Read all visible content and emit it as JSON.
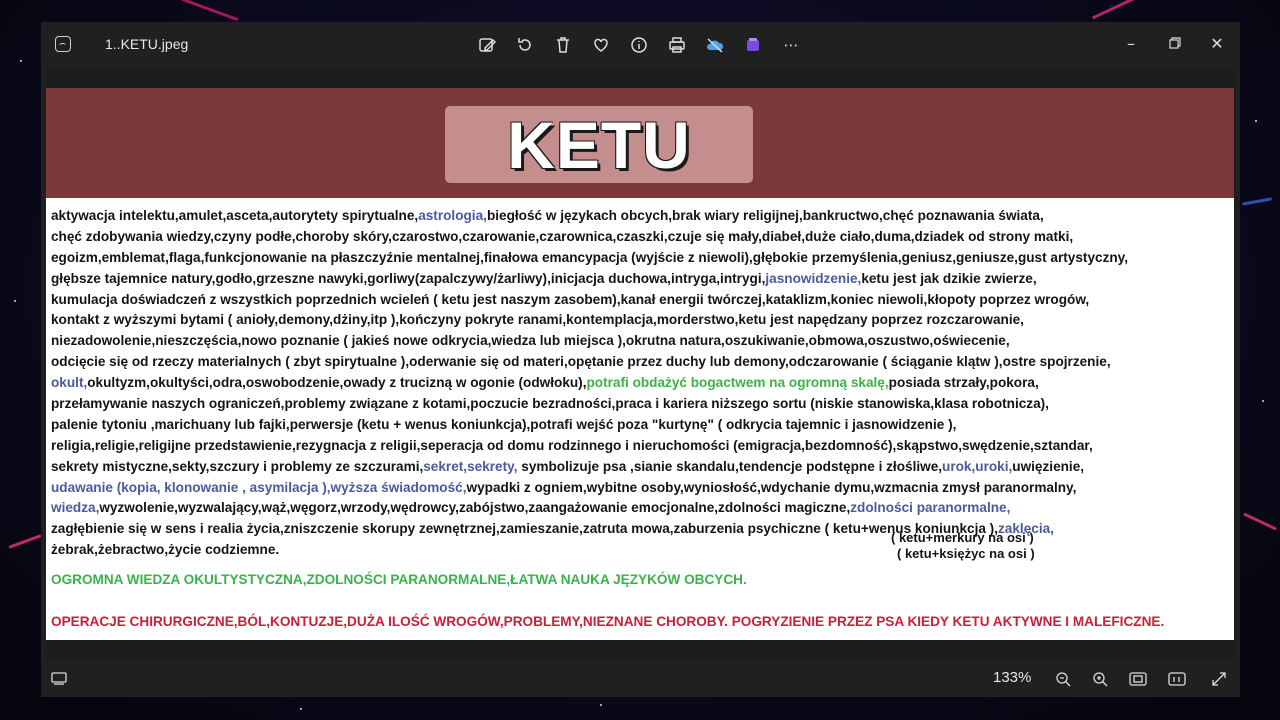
{
  "window": {
    "filename": "1..KETU.jpeg",
    "zoom": "133%"
  },
  "toolbar": {
    "icons": [
      "edit-image-icon",
      "rotate-icon",
      "delete-icon",
      "favorite-icon",
      "info-icon",
      "print-icon",
      "onedrive-icon",
      "clipchamp-icon",
      "more-icon"
    ]
  },
  "image_content": {
    "title": "KETU",
    "lines": [
      [
        {
          "t": "aktywacja intelektu,amulet,asceta,autorytety spirytualne,",
          "c": ""
        },
        {
          "t": "astrologia,",
          "c": "blue"
        },
        {
          "t": "biegłość w językach obcych,brak wiary religijnej,bankructwo,chęć poznawania świata,",
          "c": ""
        }
      ],
      [
        {
          "t": "chęć zdobywania wiedzy,czyny podłe,choroby skóry,czarostwo,czarowanie,czarownica,czaszki,czuje się mały,diabeł,duże ciało,duma,dziadek od strony matki,",
          "c": ""
        }
      ],
      [
        {
          "t": "egoizm,emblemat,flaga,funkcjonowanie na płaszczyźnie mentalnej,finałowa emancypacja (wyjście z niewoli),głębokie przemyślenia,geniusz,geniusze,gust artystyczny,",
          "c": ""
        }
      ],
      [
        {
          "t": "głębsze tajemnice natury,godło,grzeszne nawyki,gorliwy(zapalczywy/żarliwy),inicjacja duchowa,intryga,intrygi,",
          "c": ""
        },
        {
          "t": "jasnowidzenie,",
          "c": "blue"
        },
        {
          "t": "ketu jest jak dzikie zwierze,",
          "c": ""
        }
      ],
      [
        {
          "t": "kumulacja doświadczeń z wszystkich poprzednich wcieleń ( ketu jest naszym zasobem),kanał energii twórczej,kataklizm,koniec niewoli,kłopoty poprzez wrogów,",
          "c": ""
        }
      ],
      [
        {
          "t": "kontakt z wyższymi bytami ( anioły,demony,dżiny,itp ),kończyny pokryte ranami,kontemplacja,morderstwo,ketu jest napędzany poprzez rozczarowanie,",
          "c": ""
        }
      ],
      [
        {
          "t": "niezadowolenie,nieszczęścia,nowo poznanie (    jakieś nowe    odkrycia,wiedza lub miejsca ),okrutna natura,oszukiwanie,obmowa,oszustwo,oświecenie,",
          "c": ""
        }
      ],
      [
        {
          "t": "odcięcie się od rzeczy materialnych ( zbyt spirytualne ),oderwanie się od materi,opętanie przez duchy lub demony,odczarowanie ( ściąganie klątw ),ostre spojrzenie,",
          "c": ""
        }
      ],
      [
        {
          "t": "okult,",
          "c": "blue"
        },
        {
          "t": "okultyzm,okultyści,odra,oswobodzenie,owady z trucizną w ogonie (odwłoku),",
          "c": ""
        },
        {
          "t": "potrafi obdażyć bogactwem na ogromną skalę,",
          "c": "green"
        },
        {
          "t": "posiada strzały,pokora,",
          "c": ""
        }
      ],
      [
        {
          "t": "przełamywanie naszych ograniczeń,problemy związane z kotami,poczucie bezradności,praca i kariera niższego sortu (niskie stanowiska,klasa robotnicza),",
          "c": ""
        }
      ],
      [
        {
          "t": "palenie tytoniu ,marichuany lub fajki,perwersje (ketu + wenus koniunkcja),potrafi  wejść  poza \"kurtynę\" ( odkrycia tajemnic  i jasnowidzenie ),",
          "c": ""
        }
      ],
      [
        {
          "t": "religia,religie,religijne przedstawienie,rezygnacja z religii,seperacja od domu rodzinnego i nieruchomości (emigracja,bezdomność),skąpstwo,swędzenie,sztandar,",
          "c": ""
        }
      ],
      [
        {
          "t": "sekrety mistyczne,sekty,szczury i problemy ze szczurami,",
          "c": ""
        },
        {
          "t": "sekret,sekrety,",
          "c": "blue"
        },
        {
          "t": "  symbolizuje psa   ,sianie skandalu,tendencje podstępne i złośliwe,",
          "c": ""
        },
        {
          "t": "urok,uroki,",
          "c": "blue"
        },
        {
          "t": "uwięzienie,",
          "c": ""
        }
      ],
      [
        {
          "t": " udawanie (kopia, klonowanie , asymilacja ),wyższa świadomość,",
          "c": "blue"
        },
        {
          "t": "wypadki z ogniem,wybitne osoby,wyniosłość,wdychanie dymu,wzmacnia zmysł paranormalny,",
          "c": ""
        }
      ],
      [
        {
          "t": " wiedza,",
          "c": "blue"
        },
        {
          "t": "wyzwolenie,wyzwalający,wąż,węgorz,wrzody,wędrowcy,zabójstwo,zaangażowanie emocjonalne,zdolności magiczne,",
          "c": ""
        },
        {
          "t": "zdolności paranormalne,",
          "c": "blue"
        }
      ],
      [
        {
          "t": " zagłębienie się w sens i realia życia,zniszczenie skorupy zewnętrznej,zamieszanie,zatruta mowa,zaburzenia psychiczne ( ketu+wenus koniunkcja ),",
          "c": ""
        },
        {
          "t": "zaklęcia,",
          "c": "blue"
        }
      ],
      [
        {
          "t": " żebrak,żebractwo,życie codziemne.",
          "c": ""
        }
      ]
    ],
    "note1": "( ketu+merkury na osi )",
    "note2": "( ketu+księżyc  na osi )",
    "green_line": "OGROMNA WIEDZA OKULTYSTYCZNA,ZDOLNOŚCI PARANORMALNE,ŁATWA NAUKA JĘZYKÓW OBCYCH.",
    "red_line": "OPERACJE CHIRURGICZNE,BÓL,KONTUZJE,DUŻA ILOŚĆ WROGÓW,PROBLEMY,NIEZNANE CHOROBY. POGRYZIENIE PRZEZ PSA KIEDY KETU AKTYWNE I MALEFICZNE."
  },
  "colors": {
    "banner": "#7a3a3a",
    "title_box": "#c48e8e",
    "blue_text": "#4a5a9c",
    "green_text": "#3cb34a",
    "red_text": "#c9203a"
  }
}
